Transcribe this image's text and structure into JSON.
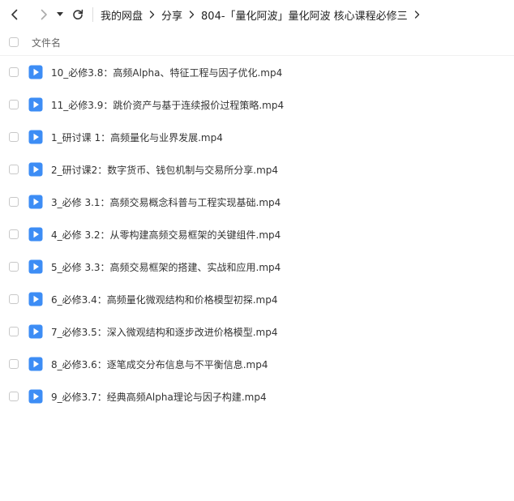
{
  "toolbar": {
    "back_icon": "chevron-left-icon",
    "forward_icon": "chevron-right-icon",
    "dropdown_icon": "caret-down-icon",
    "refresh_icon": "refresh-icon"
  },
  "breadcrumb": [
    "我的网盘",
    "分享",
    "804-「量化阿波」量化阿波 核心课程必修三"
  ],
  "list_header": {
    "name_column": "文件名"
  },
  "files": [
    "10_必修3.8：高频Alpha、特征工程与因子优化.mp4",
    "11_必修3.9：跳价资产与基于连续报价过程策略.mp4",
    "1_研讨课 1：高频量化与业界发展.mp4",
    "2_研讨课2：数字货币、钱包机制与交易所分享.mp4",
    "3_必修 3.1：高频交易概念科普与工程实现基础.mp4",
    "4_必修 3.2：从零构建高频交易框架的关键组件.mp4",
    "5_必修 3.3：高频交易框架的搭建、实战和应用.mp4",
    "6_必修3.4：高频量化微观结构和价格模型初探.mp4",
    "7_必修3.5：深入微观结构和逐步改进价格模型.mp4",
    "8_必修3.6：逐笔成交分布信息与不平衡信息.mp4",
    "9_必修3.7：经典高频Alpha理论与因子构建.mp4"
  ],
  "colors": {
    "file_icon": "#3d8df5",
    "text": "#333333",
    "header_text": "#666666"
  }
}
